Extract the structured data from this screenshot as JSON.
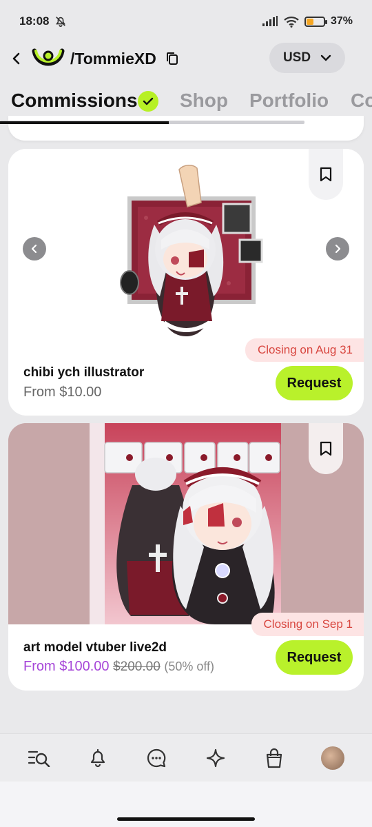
{
  "status_bar": {
    "time": "18:08",
    "battery": "37%",
    "battery_level": 0.37
  },
  "header": {
    "handle": "/TommieXD",
    "currency": "USD"
  },
  "tabs": [
    {
      "label": "Commissions",
      "active": true
    },
    {
      "label": "Shop"
    },
    {
      "label": "Portfolio"
    },
    {
      "label": "Co"
    }
  ],
  "listings": [
    {
      "title": "chibi ych illustrator",
      "price": "From $10.00",
      "closing": "Closing on Aug 31",
      "request_label": "Request"
    },
    {
      "title": "art model vtuber live2d",
      "price_sale": "From $100.00",
      "price_original": "$200.00",
      "discount": "(50% off)",
      "closing": "Closing on Sep 1",
      "request_label": "Request"
    }
  ],
  "bottom_nav": [
    "browse-icon",
    "bell-icon",
    "chat-icon",
    "sparkle-icon",
    "shopping-bag-icon",
    "avatar"
  ],
  "colors": {
    "accent": "#b9f12b",
    "sale": "#a646d8",
    "closing_text": "#d8463f",
    "closing_bg": "#fde4e4"
  }
}
